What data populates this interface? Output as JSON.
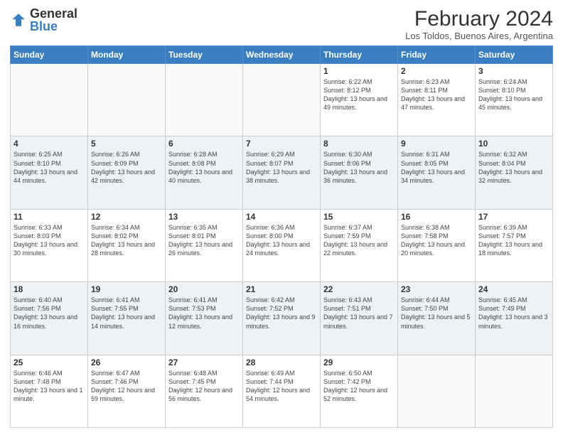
{
  "logo": {
    "general": "General",
    "blue": "Blue"
  },
  "title": "February 2024",
  "subtitle": "Los Toldos, Buenos Aires, Argentina",
  "weekdays": [
    "Sunday",
    "Monday",
    "Tuesday",
    "Wednesday",
    "Thursday",
    "Friday",
    "Saturday"
  ],
  "weeks": [
    [
      {
        "day": "",
        "info": ""
      },
      {
        "day": "",
        "info": ""
      },
      {
        "day": "",
        "info": ""
      },
      {
        "day": "",
        "info": ""
      },
      {
        "day": "1",
        "info": "Sunrise: 6:22 AM\nSunset: 8:12 PM\nDaylight: 13 hours and 49 minutes."
      },
      {
        "day": "2",
        "info": "Sunrise: 6:23 AM\nSunset: 8:11 PM\nDaylight: 13 hours and 47 minutes."
      },
      {
        "day": "3",
        "info": "Sunrise: 6:24 AM\nSunset: 8:10 PM\nDaylight: 13 hours and 45 minutes."
      }
    ],
    [
      {
        "day": "4",
        "info": "Sunrise: 6:25 AM\nSunset: 8:10 PM\nDaylight: 13 hours and 44 minutes."
      },
      {
        "day": "5",
        "info": "Sunrise: 6:26 AM\nSunset: 8:09 PM\nDaylight: 13 hours and 42 minutes."
      },
      {
        "day": "6",
        "info": "Sunrise: 6:28 AM\nSunset: 8:08 PM\nDaylight: 13 hours and 40 minutes."
      },
      {
        "day": "7",
        "info": "Sunrise: 6:29 AM\nSunset: 8:07 PM\nDaylight: 13 hours and 38 minutes."
      },
      {
        "day": "8",
        "info": "Sunrise: 6:30 AM\nSunset: 8:06 PM\nDaylight: 13 hours and 36 minutes."
      },
      {
        "day": "9",
        "info": "Sunrise: 6:31 AM\nSunset: 8:05 PM\nDaylight: 13 hours and 34 minutes."
      },
      {
        "day": "10",
        "info": "Sunrise: 6:32 AM\nSunset: 8:04 PM\nDaylight: 13 hours and 32 minutes."
      }
    ],
    [
      {
        "day": "11",
        "info": "Sunrise: 6:33 AM\nSunset: 8:03 PM\nDaylight: 13 hours and 30 minutes."
      },
      {
        "day": "12",
        "info": "Sunrise: 6:34 AM\nSunset: 8:02 PM\nDaylight: 13 hours and 28 minutes."
      },
      {
        "day": "13",
        "info": "Sunrise: 6:35 AM\nSunset: 8:01 PM\nDaylight: 13 hours and 26 minutes."
      },
      {
        "day": "14",
        "info": "Sunrise: 6:36 AM\nSunset: 8:00 PM\nDaylight: 13 hours and 24 minutes."
      },
      {
        "day": "15",
        "info": "Sunrise: 6:37 AM\nSunset: 7:59 PM\nDaylight: 13 hours and 22 minutes."
      },
      {
        "day": "16",
        "info": "Sunrise: 6:38 AM\nSunset: 7:58 PM\nDaylight: 13 hours and 20 minutes."
      },
      {
        "day": "17",
        "info": "Sunrise: 6:39 AM\nSunset: 7:57 PM\nDaylight: 13 hours and 18 minutes."
      }
    ],
    [
      {
        "day": "18",
        "info": "Sunrise: 6:40 AM\nSunset: 7:56 PM\nDaylight: 13 hours and 16 minutes."
      },
      {
        "day": "19",
        "info": "Sunrise: 6:41 AM\nSunset: 7:55 PM\nDaylight: 13 hours and 14 minutes."
      },
      {
        "day": "20",
        "info": "Sunrise: 6:41 AM\nSunset: 7:53 PM\nDaylight: 13 hours and 12 minutes."
      },
      {
        "day": "21",
        "info": "Sunrise: 6:42 AM\nSunset: 7:52 PM\nDaylight: 13 hours and 9 minutes."
      },
      {
        "day": "22",
        "info": "Sunrise: 6:43 AM\nSunset: 7:51 PM\nDaylight: 13 hours and 7 minutes."
      },
      {
        "day": "23",
        "info": "Sunrise: 6:44 AM\nSunset: 7:50 PM\nDaylight: 13 hours and 5 minutes."
      },
      {
        "day": "24",
        "info": "Sunrise: 6:45 AM\nSunset: 7:49 PM\nDaylight: 13 hours and 3 minutes."
      }
    ],
    [
      {
        "day": "25",
        "info": "Sunrise: 6:46 AM\nSunset: 7:48 PM\nDaylight: 13 hours and 1 minute."
      },
      {
        "day": "26",
        "info": "Sunrise: 6:47 AM\nSunset: 7:46 PM\nDaylight: 12 hours and 59 minutes."
      },
      {
        "day": "27",
        "info": "Sunrise: 6:48 AM\nSunset: 7:45 PM\nDaylight: 12 hours and 56 minutes."
      },
      {
        "day": "28",
        "info": "Sunrise: 6:49 AM\nSunset: 7:44 PM\nDaylight: 12 hours and 54 minutes."
      },
      {
        "day": "29",
        "info": "Sunrise: 6:50 AM\nSunset: 7:42 PM\nDaylight: 12 hours and 52 minutes."
      },
      {
        "day": "",
        "info": ""
      },
      {
        "day": "",
        "info": ""
      }
    ]
  ]
}
